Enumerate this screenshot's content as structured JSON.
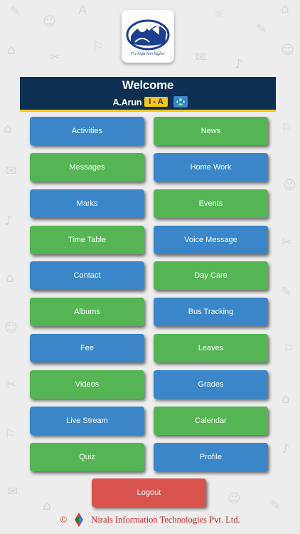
{
  "header": {
    "logo_tagline": "Fly high Aim higher",
    "welcome": "Welcome",
    "student_name": "A.Arun",
    "class_badge": "I - A"
  },
  "menu": [
    {
      "label": "Activities",
      "color": "blue"
    },
    {
      "label": "News",
      "color": "green"
    },
    {
      "label": "Messages",
      "color": "green"
    },
    {
      "label": "Home Work",
      "color": "blue"
    },
    {
      "label": "Marks",
      "color": "blue"
    },
    {
      "label": "Events",
      "color": "green"
    },
    {
      "label": "Time Table",
      "color": "green"
    },
    {
      "label": "Voice Message",
      "color": "blue"
    },
    {
      "label": "Contact",
      "color": "blue"
    },
    {
      "label": "Day Care",
      "color": "green"
    },
    {
      "label": "Albums",
      "color": "green"
    },
    {
      "label": "Bus Tracking",
      "color": "blue"
    },
    {
      "label": "Fee",
      "color": "blue"
    },
    {
      "label": "Leaves",
      "color": "green"
    },
    {
      "label": "Videos",
      "color": "green"
    },
    {
      "label": "Grades",
      "color": "blue"
    },
    {
      "label": "Live Stream",
      "color": "blue"
    },
    {
      "label": "Calendar",
      "color": "green"
    },
    {
      "label": "Quiz",
      "color": "green"
    },
    {
      "label": "Profile",
      "color": "blue"
    }
  ],
  "logout_label": "Logout",
  "footer": {
    "copyright": "©",
    "company": "Nirals Information Technologies Pvt. Ltd."
  },
  "colors": {
    "blue": "#3a86c8",
    "green": "#55b554",
    "red": "#d9534f",
    "navy": "#0c2f52",
    "yellow": "#f3c715"
  }
}
